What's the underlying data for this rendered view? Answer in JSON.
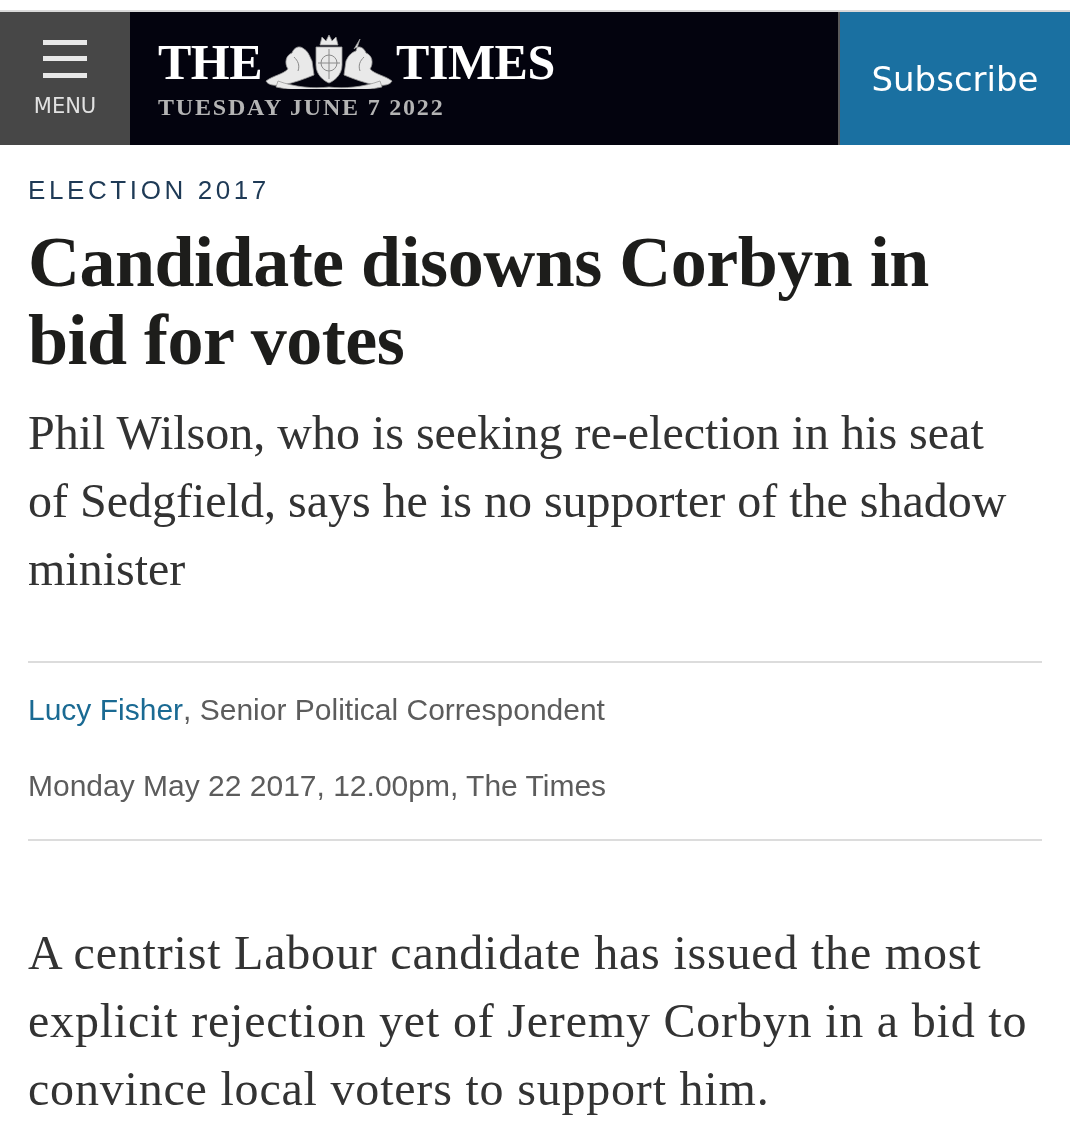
{
  "header": {
    "menu": {
      "label": "MENU"
    },
    "masthead": {
      "left": "THE",
      "right": "TIMES"
    },
    "date": "TUESDAY JUNE 7 2022",
    "subscribe": "Subscribe"
  },
  "article": {
    "section": "ELECTION 2017",
    "headline": "Candidate disowns Corbyn in bid for votes",
    "standfirst": "Phil Wilson, who is seeking re-election in his seat of Sedgfield, says he is no supporter of the shadow minister",
    "byline": {
      "author": "Lucy Fisher",
      "role": ", Senior Political Correspondent"
    },
    "dateline": "Monday May 22 2017, 12.00pm, The Times",
    "body": [
      "A centrist Labour candidate has issued the most explicit rejection yet of Jeremy Corbyn in a bid to convince local voters to support him."
    ]
  }
}
